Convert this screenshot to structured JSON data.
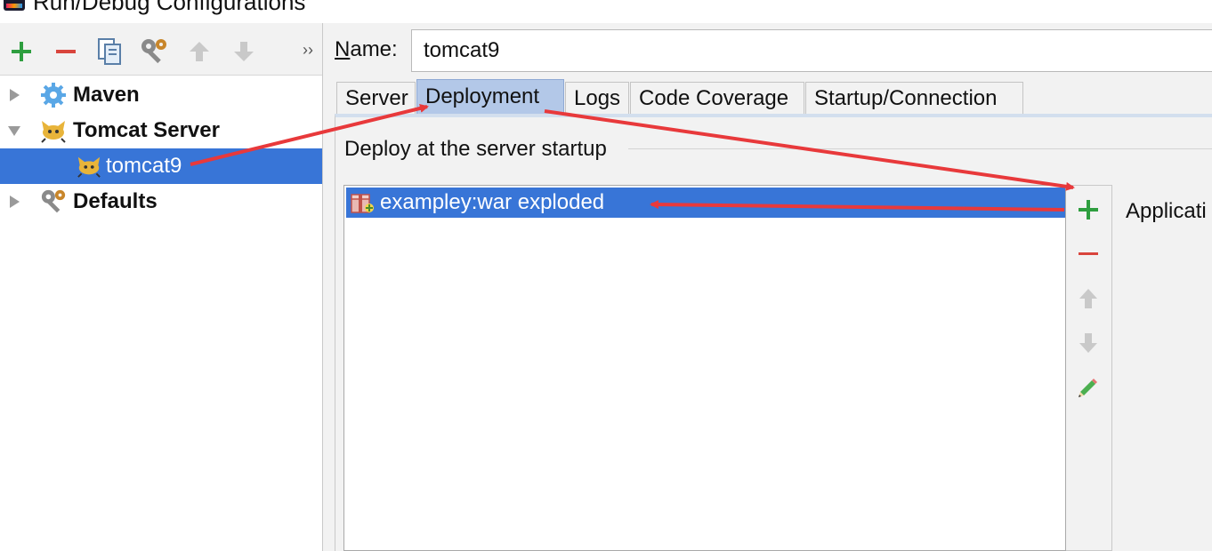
{
  "window": {
    "title": "Run/Debug Configurations"
  },
  "toolbar": {
    "icons": [
      "add-icon",
      "remove-icon",
      "copy-icon",
      "settings-wrench-icon",
      "move-up-icon",
      "move-down-icon",
      "more-icon"
    ],
    "more_label": "››"
  },
  "tree": {
    "items": [
      {
        "label": "Maven",
        "icon": "maven-gear-icon",
        "expanded": false
      },
      {
        "label": "Tomcat Server",
        "icon": "tomcat-icon",
        "expanded": true
      },
      {
        "label": "tomcat9",
        "icon": "tomcat-icon",
        "selected": true
      },
      {
        "label": "Defaults",
        "icon": "wrench-icon",
        "expanded": false
      }
    ]
  },
  "name": {
    "label_mnemonic": "N",
    "label_rest": "ame:",
    "value": "tomcat9"
  },
  "tabs": [
    {
      "label": "Server"
    },
    {
      "label": "Deployment",
      "active": true
    },
    {
      "label": "Logs"
    },
    {
      "label": "Code Coverage"
    },
    {
      "label": "Startup/Connection"
    }
  ],
  "deployment": {
    "section_label": "Deploy at the server startup",
    "items": [
      {
        "label": "exampley:war exploded",
        "icon": "artifact-icon",
        "selected": true
      }
    ],
    "side_buttons": [
      "add-icon",
      "remove-icon",
      "move-up-icon",
      "move-down-icon",
      "edit-pencil-icon"
    ],
    "application_context_label": "Applicati"
  },
  "colors": {
    "selection": "#3875d7",
    "active_tab": "#b3c8e8",
    "add_green": "#2e9e3f",
    "remove_red": "#d9453d",
    "annotation_red": "#e8393b"
  }
}
